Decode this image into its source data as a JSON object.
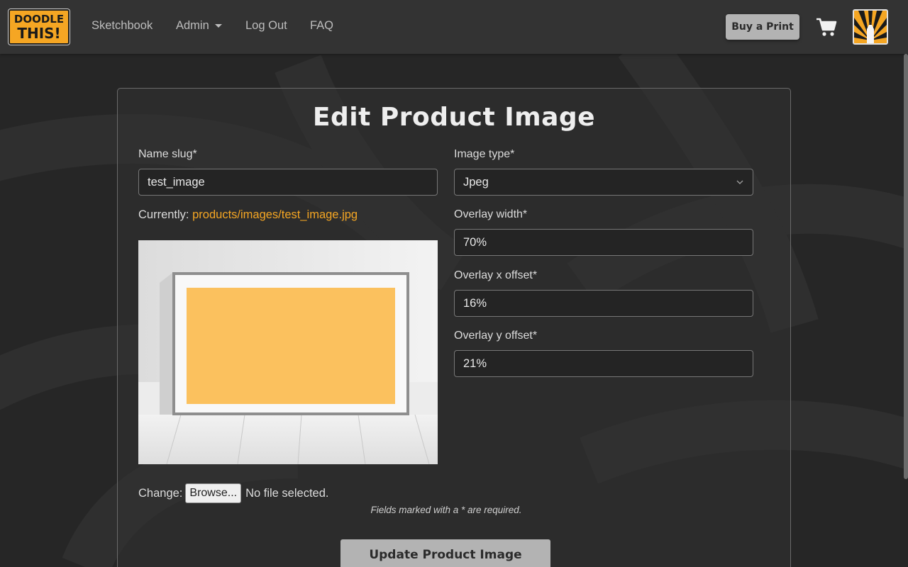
{
  "brand": {
    "line1": "DOODLE",
    "line2": "THIS!"
  },
  "nav": {
    "links": [
      "Sketchbook",
      "Admin",
      "Log Out",
      "FAQ"
    ],
    "buy_print": "Buy a Print"
  },
  "form": {
    "title": "Edit Product Image",
    "name_slug": {
      "label": "Name slug*",
      "value": "test_image"
    },
    "image_type": {
      "label": "Image type*",
      "value": "Jpeg"
    },
    "currently_label": "Currently:",
    "currently_link": "products/images/test_image.jpg",
    "overlay_width": {
      "label": "Overlay width*",
      "value": "70%"
    },
    "overlay_x": {
      "label": "Overlay x offset*",
      "value": "16%"
    },
    "overlay_y": {
      "label": "Overlay y offset*",
      "value": "21%"
    },
    "change_label": "Change:",
    "browse_label": "Browse...",
    "no_file": "No file selected.",
    "required_note": "Fields marked with a * are required.",
    "submit": "Update Product Image"
  },
  "colors": {
    "accent": "#f5a623",
    "background": "#262626",
    "navbar": "#333333",
    "button": "#b3b3b3"
  }
}
